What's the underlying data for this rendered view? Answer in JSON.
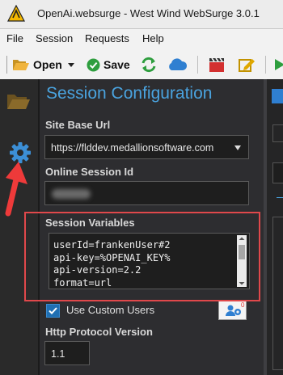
{
  "window": {
    "title": "OpenAi.websurge - West Wind WebSurge 3.0.1"
  },
  "menu": [
    "File",
    "Session",
    "Requests",
    "Help"
  ],
  "toolbar": {
    "open_label": "Open",
    "save_label": "Save"
  },
  "icons": {
    "app": "websurge-logo-icon",
    "open": "folder-open-icon",
    "dropdown": "chevron-down-icon",
    "save": "check-circle-icon",
    "refresh": "refresh-icon",
    "cloud": "cloud-icon",
    "record": "clapperboard-icon",
    "edit": "edit-icon",
    "run": "play-icon",
    "sidebar_folder": "folder-icon",
    "sidebar_settings": "gear-icon",
    "annotation": "red-arrow-icon",
    "users": "users-settings-icon"
  },
  "panel": {
    "title": "Session Configuration",
    "site_base_url": {
      "label": "Site Base Url",
      "value": "https://flddev.medallionsoftware.com"
    },
    "online_session_id": {
      "label": "Online Session Id",
      "value": ""
    },
    "session_variables": {
      "label": "Session Variables",
      "lines": [
        "userId=frankenUser#2",
        "api-key=%OPENAI_KEY%",
        "api-version=2.2",
        "format=url"
      ]
    },
    "custom_users": {
      "label": "Use Custom Users",
      "checked": true,
      "count": "0"
    },
    "http_protocol": {
      "label": "Http Protocol Version",
      "value": "1.1"
    }
  },
  "colors": {
    "accent": "#4aa3df",
    "highlight": "#e0484b",
    "panel_bg": "#2d2d30",
    "input_bg": "#1e1e1e"
  }
}
